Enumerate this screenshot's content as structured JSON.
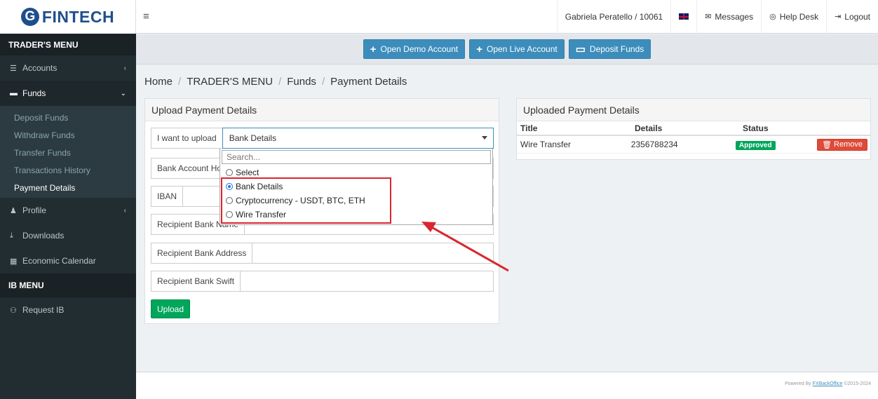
{
  "brand": {
    "logo_letter": "G",
    "name": "FINTECH"
  },
  "sidebar": {
    "traders_menu": "TRADER'S MENU",
    "accounts": "Accounts",
    "funds": "Funds",
    "funds_sub": [
      "Deposit Funds",
      "Withdraw Funds",
      "Transfer Funds",
      "Transactions History",
      "Payment Details"
    ],
    "profile": "Profile",
    "downloads": "Downloads",
    "economic_calendar": "Economic Calendar",
    "ib_menu": "IB MENU",
    "request_ib": "Request IB"
  },
  "topbar": {
    "user": "Gabriela Peratello / 10061",
    "messages": "Messages",
    "help_desk": "Help Desk",
    "logout": "Logout"
  },
  "actions": {
    "open_demo": "Open Demo Account",
    "open_live": "Open Live Account",
    "deposit": "Deposit Funds"
  },
  "breadcrumb": [
    "Home",
    "TRADER'S MENU",
    "Funds",
    "Payment Details"
  ],
  "upload": {
    "title": "Upload Payment Details",
    "i_want_label": "I want to upload",
    "selected": "Bank Details",
    "fields": [
      "Bank Account Hol",
      "IBAN",
      "Recipient Bank Name",
      "Recipient Bank Address",
      "Recipient Bank Swift"
    ],
    "upload_button": "Upload",
    "dropdown": {
      "search_placeholder": "Search...",
      "options": [
        {
          "label": "Select",
          "checked": false
        },
        {
          "label": "Bank Details",
          "checked": true
        },
        {
          "label": "Cryptocurrency - USDT, BTC, ETH",
          "checked": false
        },
        {
          "label": "Wire Transfer",
          "checked": false
        }
      ]
    }
  },
  "uploaded": {
    "title": "Uploaded Payment Details",
    "headers": [
      "Title",
      "Details",
      "Status"
    ],
    "rows": [
      {
        "title": "Wire Transfer",
        "details": "2356788234",
        "status": "Approved",
        "action": "Remove"
      }
    ]
  },
  "footer": {
    "prefix": "Powered By ",
    "link": "FXBackOffice",
    "suffix": " ©2015-2024"
  },
  "colors": {
    "sidebar": "#222d32",
    "primary": "#3c8dbc",
    "success": "#00a65a",
    "danger": "#dd4b39",
    "annotation": "#d9262f"
  }
}
